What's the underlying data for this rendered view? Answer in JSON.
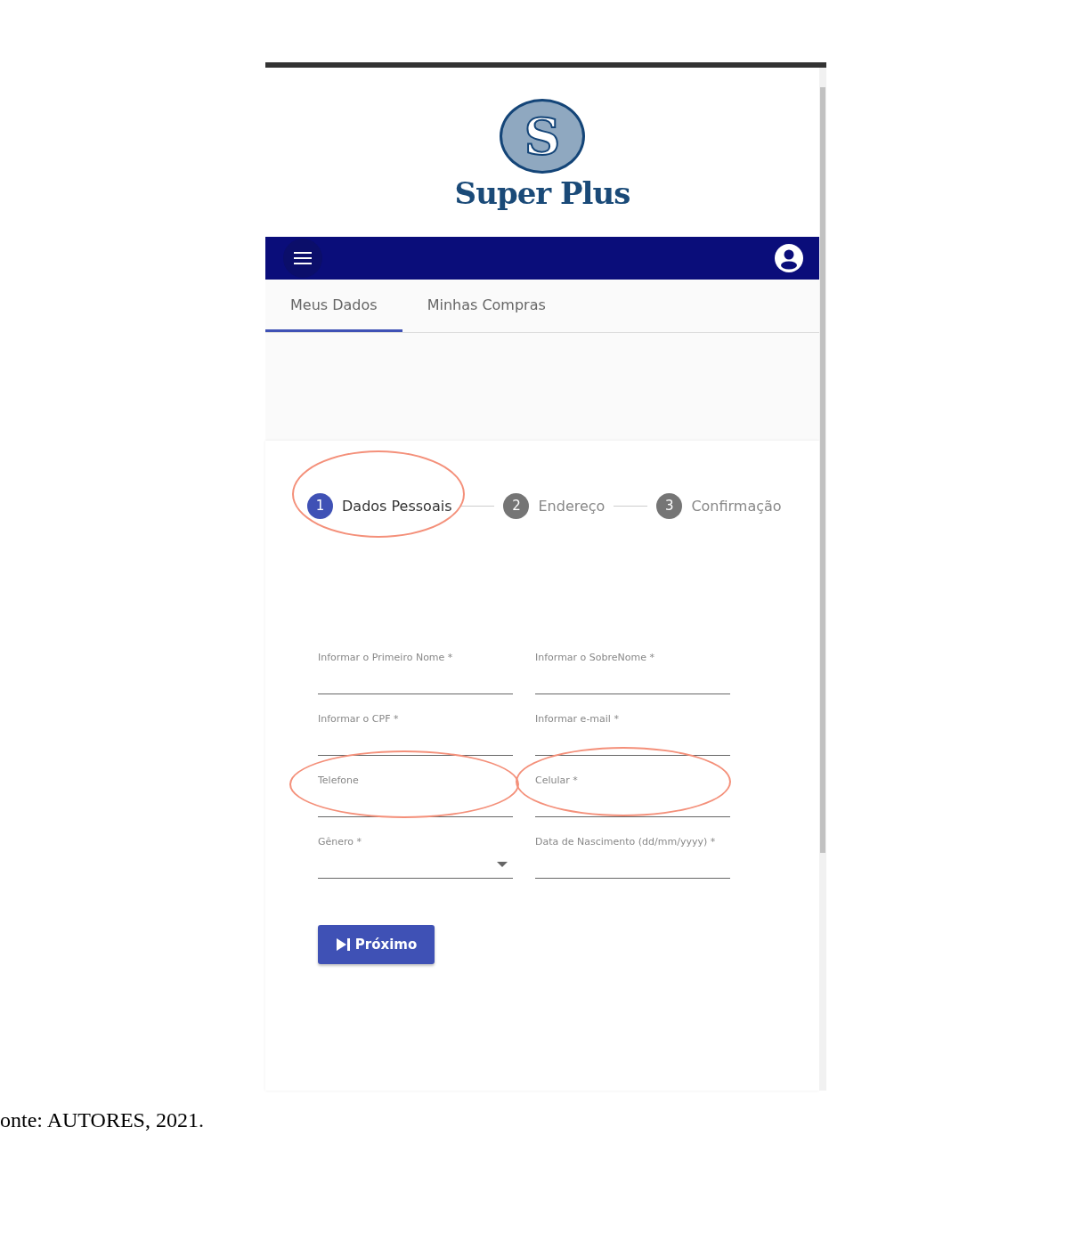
{
  "logo": {
    "mark": "S",
    "name": "Super Plus"
  },
  "tabs": [
    {
      "label": "Meus Dados",
      "selected": true
    },
    {
      "label": "Minhas Compras",
      "selected": false
    }
  ],
  "steps": [
    {
      "number": "1",
      "label": "Dados Pessoais",
      "selected": true,
      "highlighted": true
    },
    {
      "number": "2",
      "label": "Endereço",
      "selected": false,
      "highlighted": false
    },
    {
      "number": "3",
      "label": "Confirmação",
      "selected": false,
      "highlighted": false
    }
  ],
  "fields": [
    {
      "kind": "text",
      "label": "Informar o Primeiro Nome *",
      "highlighted": false
    },
    {
      "kind": "text",
      "label": "Informar o SobreNome *",
      "highlighted": false
    },
    {
      "kind": "text",
      "label": "Informar o CPF *",
      "highlighted": false
    },
    {
      "kind": "text",
      "label": "Informar e-mail *",
      "highlighted": false
    },
    {
      "kind": "text",
      "label": "Telefone",
      "highlighted": true
    },
    {
      "kind": "text",
      "label": "Celular *",
      "highlighted": true
    },
    {
      "kind": "select",
      "label": "Gênero *",
      "highlighted": false
    },
    {
      "kind": "text",
      "label": "Data de Nascimento (dd/mm/yyyy) *",
      "highlighted": false
    }
  ],
  "next_button": "Próximo",
  "caption": "onte: AUTORES, 2021."
}
